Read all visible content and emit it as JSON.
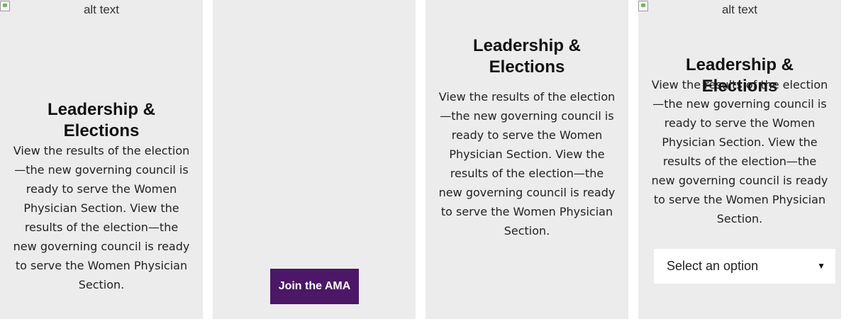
{
  "cards": [
    {
      "image_alt": "alt text",
      "title": "Leadership & Elections",
      "body": "View the results of the election—the new governing council is ready to serve the Women Physician Section. View the results of the election—the new governing council is ready to serve the Women Physician Section."
    },
    {
      "button_label": "Join the AMA",
      "button_color": "#4b1766"
    },
    {
      "title": "Leadership & Elections",
      "body": "View the results of the election—the new governing council is ready to serve the Women Physician Section. View the results of the election—the new governing council is ready to serve the Women Physician Section."
    },
    {
      "image_alt": "alt text",
      "title": "Leadership & Elections",
      "body": "View the results of the election—the new governing council is ready to serve the Women Physician Section. View the results of the election—the new governing council is ready to serve the Women Physician Section.",
      "select": {
        "selected": "Select an option",
        "icon": "triangle-down-icon"
      }
    }
  ],
  "icons": {
    "broken_image": "broken-image-icon"
  },
  "colors": {
    "card_background": "#ececec",
    "accent": "#4b1766"
  }
}
